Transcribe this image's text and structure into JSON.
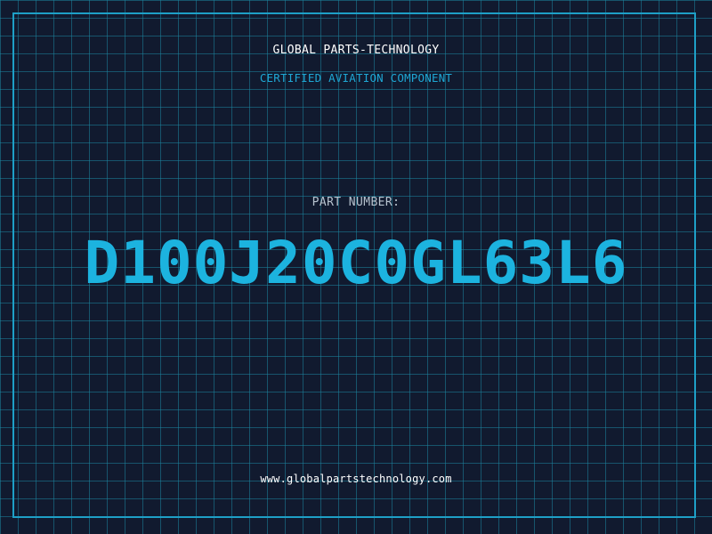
{
  "header": {
    "company": "GLOBAL PARTS-TECHNOLOGY",
    "subtitle": "CERTIFIED AVIATION COMPONENT"
  },
  "part": {
    "label": "PART NUMBER:",
    "number": "D100J20C0GL63L6"
  },
  "footer": {
    "url": "www.globalpartstechnology.com"
  },
  "colors": {
    "background": "#111a2f",
    "grid": "#1b849e",
    "accent": "#1cb3df",
    "text": "#ffffff"
  }
}
